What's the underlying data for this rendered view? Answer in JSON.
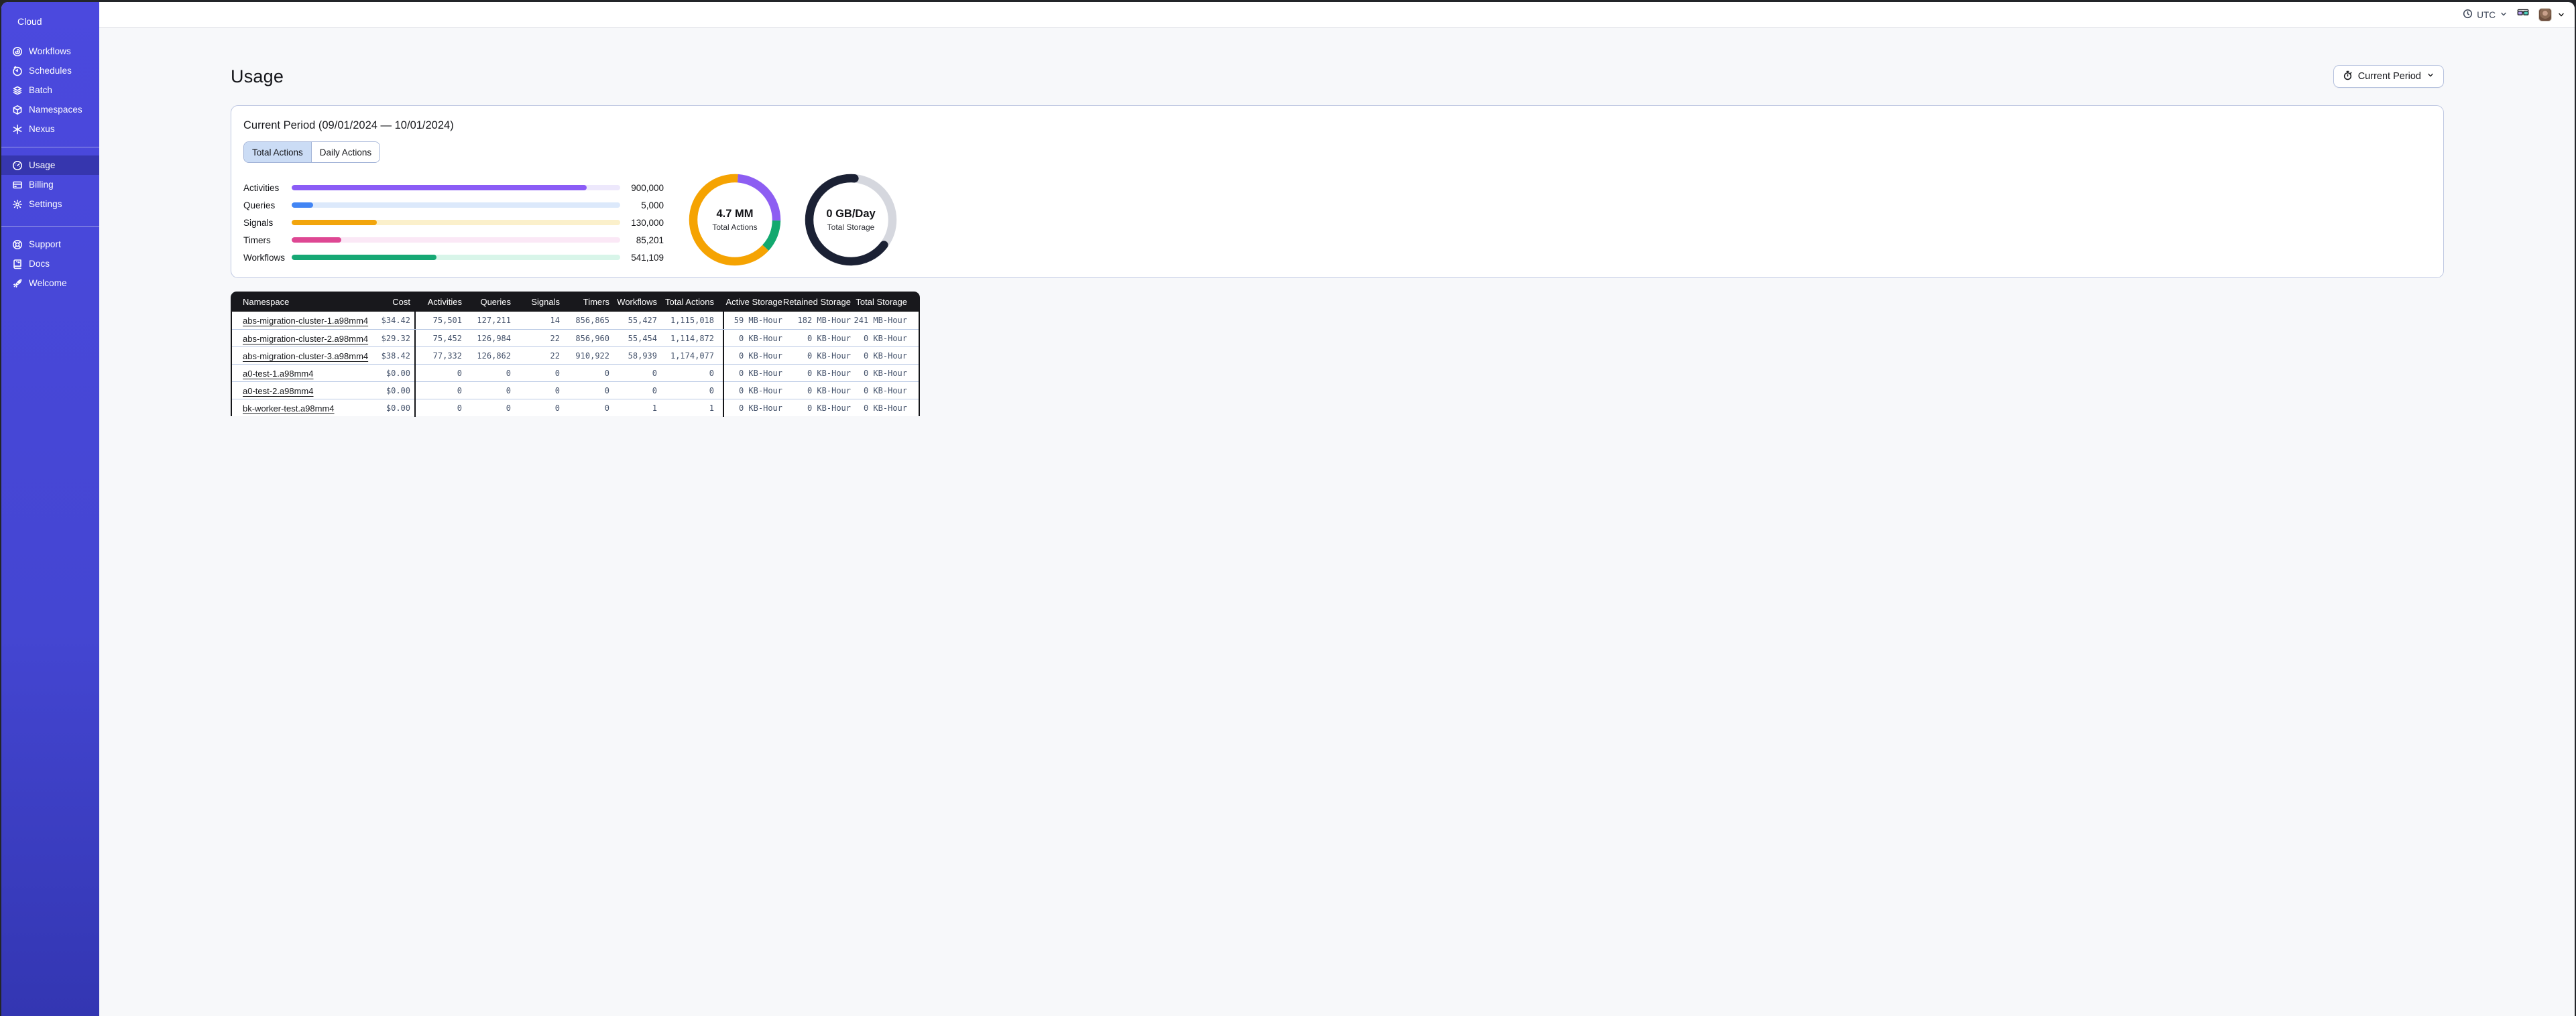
{
  "sidebar": {
    "brand": {
      "label": "Cloud",
      "icon": "temporal-logo-icon",
      "collapse_icon": "chevron-left-icon"
    },
    "nav_main": [
      {
        "label": "Workflows",
        "icon": "workflows-icon"
      },
      {
        "label": "Schedules",
        "icon": "schedules-clock-icon"
      },
      {
        "label": "Batch",
        "icon": "batch-layers-icon"
      },
      {
        "label": "Namespaces",
        "icon": "namespaces-cube-icon"
      },
      {
        "label": "Nexus",
        "icon": "nexus-asterisk-icon"
      }
    ],
    "nav_account": [
      {
        "label": "Usage",
        "icon": "usage-gauge-icon",
        "selected": true
      },
      {
        "label": "Billing",
        "icon": "billing-card-icon"
      },
      {
        "label": "Settings",
        "icon": "settings-gear-icon"
      }
    ],
    "nav_footer": [
      {
        "label": "Support",
        "icon": "support-lifering-icon"
      },
      {
        "label": "Docs",
        "icon": "docs-book-icon"
      },
      {
        "label": "Welcome",
        "icon": "welcome-rocket-icon"
      }
    ]
  },
  "topbar": {
    "timezone": "UTC",
    "timezone_icon": "clock-icon",
    "feedback_icon": "glasses-icon",
    "avatar": "user-avatar"
  },
  "page": {
    "title": "Usage",
    "period_button": {
      "label": "Current Period",
      "icon": "stopwatch-icon"
    }
  },
  "usage_card": {
    "title": "Current Period (09/01/2024 — 10/01/2024)",
    "tabs": [
      {
        "label": "Total Actions",
        "selected": true
      },
      {
        "label": "Daily Actions",
        "selected": false
      }
    ]
  },
  "chart_data": [
    {
      "type": "bar",
      "title": "Total Actions by type",
      "categories": [
        "Activities",
        "Queries",
        "Signals",
        "Timers",
        "Workflows"
      ],
      "values": [
        900000,
        5000,
        130000,
        85201,
        541109
      ],
      "value_labels": [
        "900,000",
        "5,000",
        "130,000",
        "85,201",
        "541,109"
      ],
      "fill_pct": [
        89.7,
        6.5,
        26,
        15,
        44
      ],
      "colors": [
        "#8B5CF6",
        "#4285F4",
        "#F2A50C",
        "#DE4793",
        "#16A874"
      ],
      "track_colors": [
        "#EDE8FC",
        "#DCE9FB",
        "#FBF0CB",
        "#FBE8F6",
        "#D8F5E9"
      ]
    },
    {
      "type": "donut",
      "id": "donut-actions",
      "center_value": "4.7 MM",
      "center_label": "Total Actions",
      "start_deg": 4,
      "segments": [
        {
          "name": "activities",
          "color": "#8D5EF2",
          "pct": 24.2
        },
        {
          "name": "workflows",
          "color": "#13A96F",
          "pct": 11.5
        },
        {
          "name": "signals",
          "color": "#F5A302",
          "pct": 64.3
        }
      ]
    },
    {
      "type": "donut",
      "id": "donut-storage",
      "center_value": "0 GB/Day",
      "center_label": "Total Storage",
      "start_deg": 5,
      "segments": [
        {
          "name": "remaining",
          "color": "#D5D7DE",
          "pct": 34
        },
        {
          "name": "used",
          "color": "#1B2134",
          "pct": 66,
          "cap": "round"
        }
      ]
    }
  ],
  "table": {
    "columns": [
      "Namespace",
      "Cost",
      "Activities",
      "Queries",
      "Signals",
      "Timers",
      "Workflows",
      "Total Actions",
      "Active Storage",
      "Retained Storage",
      "Total Storage"
    ],
    "rows": [
      {
        "namespace": "abs-migration-cluster-1.a98mm4",
        "cost": "$34.42",
        "activities": "75,501",
        "queries": "127,211",
        "signals": "14",
        "timers": "856,865",
        "workflows": "55,427",
        "total_actions": "1,115,018",
        "active_storage": "59 MB-Hour",
        "retained_storage": "182 MB-Hour",
        "total_storage": "241 MB-Hour"
      },
      {
        "namespace": "abs-migration-cluster-2.a98mm4",
        "cost": "$29.32",
        "activities": "75,452",
        "queries": "126,984",
        "signals": "22",
        "timers": "856,960",
        "workflows": "55,454",
        "total_actions": "1,114,872",
        "active_storage": "0 KB-Hour",
        "retained_storage": "0 KB-Hour",
        "total_storage": "0 KB-Hour"
      },
      {
        "namespace": "abs-migration-cluster-3.a98mm4",
        "cost": "$38.42",
        "activities": "77,332",
        "queries": "126,862",
        "signals": "22",
        "timers": "910,922",
        "workflows": "58,939",
        "total_actions": "1,174,077",
        "active_storage": "0 KB-Hour",
        "retained_storage": "0 KB-Hour",
        "total_storage": "0 KB-Hour"
      },
      {
        "namespace": "a0-test-1.a98mm4",
        "cost": "$0.00",
        "activities": "0",
        "queries": "0",
        "signals": "0",
        "timers": "0",
        "workflows": "0",
        "total_actions": "0",
        "active_storage": "0 KB-Hour",
        "retained_storage": "0 KB-Hour",
        "total_storage": "0 KB-Hour"
      },
      {
        "namespace": "a0-test-2.a98mm4",
        "cost": "$0.00",
        "activities": "0",
        "queries": "0",
        "signals": "0",
        "timers": "0",
        "workflows": "0",
        "total_actions": "0",
        "active_storage": "0 KB-Hour",
        "retained_storage": "0 KB-Hour",
        "total_storage": "0 KB-Hour"
      },
      {
        "namespace": "bk-worker-test.a98mm4",
        "cost": "$0.00",
        "activities": "0",
        "queries": "0",
        "signals": "0",
        "timers": "0",
        "workflows": "1",
        "total_actions": "1",
        "active_storage": "0 KB-Hour",
        "retained_storage": "0 KB-Hour",
        "total_storage": "0 KB-Hour"
      }
    ]
  }
}
